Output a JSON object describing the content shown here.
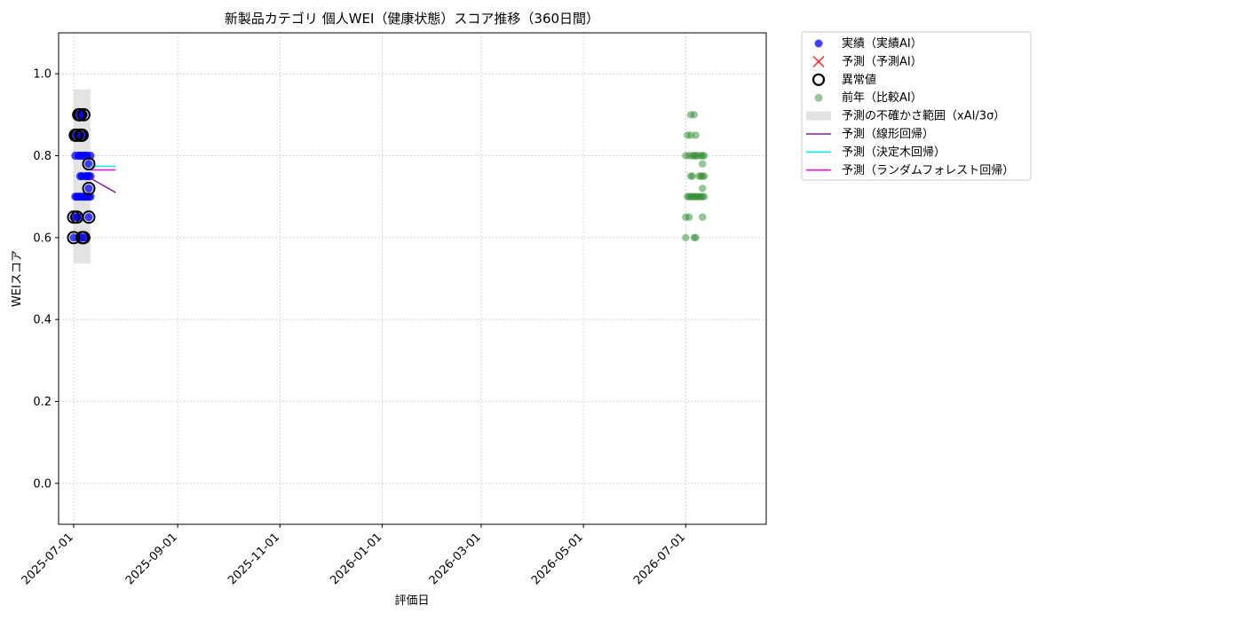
{
  "chart_data": {
    "type": "scatter",
    "title": "新製品カテゴリ 個人WEI（健康状態）スコア推移（360日間）",
    "xlabel": "評価日",
    "ylabel": "WEIスコア",
    "x_type": "date",
    "xlim": [
      "2025-06-22",
      "2026-08-18"
    ],
    "ylim": [
      -0.1,
      1.1
    ],
    "x_ticks": [
      "2025-07-01",
      "2025-09-01",
      "2025-11-01",
      "2026-01-01",
      "2026-03-01",
      "2026-05-01",
      "2026-07-01"
    ],
    "y_ticks": [
      0.0,
      0.2,
      0.4,
      0.6,
      0.8,
      1.0
    ],
    "y_tick_labels": [
      "0.0",
      "0.2",
      "0.4",
      "0.6",
      "0.8",
      "1.0"
    ],
    "grid": true,
    "legend_position": "outside-top-right",
    "legend": [
      {
        "label": "実績（実績AI）",
        "kind": "dot",
        "color": "#0000ff"
      },
      {
        "label": "予測（予測AI）",
        "kind": "x",
        "color": "#ff0000"
      },
      {
        "label": "異常値",
        "kind": "ring",
        "color": "#000000"
      },
      {
        "label": "前年（比較AI）",
        "kind": "dot",
        "color": "#2e8b2e"
      },
      {
        "label": "予測の不確かさ範囲（xAI/3σ）",
        "kind": "band",
        "color": "#c8c8c8"
      },
      {
        "label": "予測（線形回帰）",
        "kind": "line",
        "color": "#8b1a9b"
      },
      {
        "label": "予測（決定木回帰）",
        "kind": "line",
        "color": "#00e5ee"
      },
      {
        "label": "予測（ランダムフォレスト回帰）",
        "kind": "line",
        "color": "#ff00ff"
      }
    ],
    "uncertainty_band": {
      "x": [
        "2025-07-01",
        "2025-07-11"
      ],
      "y": [
        0.537,
        0.962
      ]
    },
    "series": [
      {
        "name": "実績（実績AI）",
        "color": "#0000ff",
        "points": [
          {
            "x": "2025-07-01",
            "y": 0.6
          },
          {
            "x": "2025-07-01",
            "y": 0.65
          },
          {
            "x": "2025-07-02",
            "y": 0.7
          },
          {
            "x": "2025-07-02",
            "y": 0.8
          },
          {
            "x": "2025-07-02",
            "y": 0.85
          },
          {
            "x": "2025-07-03",
            "y": 0.7
          },
          {
            "x": "2025-07-03",
            "y": 0.85
          },
          {
            "x": "2025-07-03",
            "y": 0.65
          },
          {
            "x": "2025-07-04",
            "y": 0.7
          },
          {
            "x": "2025-07-04",
            "y": 0.8
          },
          {
            "x": "2025-07-04",
            "y": 0.9
          },
          {
            "x": "2025-07-04",
            "y": 0.65
          },
          {
            "x": "2025-07-05",
            "y": 0.7
          },
          {
            "x": "2025-07-05",
            "y": 0.75
          },
          {
            "x": "2025-07-05",
            "y": 0.8
          },
          {
            "x": "2025-07-05",
            "y": 0.85
          },
          {
            "x": "2025-07-05",
            "y": 0.9
          },
          {
            "x": "2025-07-06",
            "y": 0.7
          },
          {
            "x": "2025-07-06",
            "y": 0.75
          },
          {
            "x": "2025-07-06",
            "y": 0.8
          },
          {
            "x": "2025-07-06",
            "y": 0.85
          },
          {
            "x": "2025-07-06",
            "y": 0.6
          },
          {
            "x": "2025-07-06",
            "y": 0.9
          },
          {
            "x": "2025-07-07",
            "y": 0.7
          },
          {
            "x": "2025-07-07",
            "y": 0.8
          },
          {
            "x": "2025-07-07",
            "y": 0.9
          },
          {
            "x": "2025-07-07",
            "y": 0.6
          },
          {
            "x": "2025-07-08",
            "y": 0.7
          },
          {
            "x": "2025-07-08",
            "y": 0.8
          },
          {
            "x": "2025-07-08",
            "y": 0.75
          },
          {
            "x": "2025-07-09",
            "y": 0.7
          },
          {
            "x": "2025-07-09",
            "y": 0.75
          },
          {
            "x": "2025-07-09",
            "y": 0.8
          },
          {
            "x": "2025-07-10",
            "y": 0.7
          },
          {
            "x": "2025-07-10",
            "y": 0.75
          },
          {
            "x": "2025-07-10",
            "y": 0.78
          },
          {
            "x": "2025-07-10",
            "y": 0.72
          },
          {
            "x": "2025-07-10",
            "y": 0.65
          },
          {
            "x": "2025-07-11",
            "y": 0.7
          },
          {
            "x": "2025-07-11",
            "y": 0.75
          },
          {
            "x": "2025-07-11",
            "y": 0.8
          }
        ]
      },
      {
        "name": "異常値",
        "color": "#000000",
        "points": [
          {
            "x": "2025-07-01",
            "y": 0.6
          },
          {
            "x": "2025-07-01",
            "y": 0.65
          },
          {
            "x": "2025-07-02",
            "y": 0.85
          },
          {
            "x": "2025-07-03",
            "y": 0.85
          },
          {
            "x": "2025-07-03",
            "y": 0.65
          },
          {
            "x": "2025-07-04",
            "y": 0.9
          },
          {
            "x": "2025-07-05",
            "y": 0.9
          },
          {
            "x": "2025-07-05",
            "y": 0.85
          },
          {
            "x": "2025-07-06",
            "y": 0.85
          },
          {
            "x": "2025-07-06",
            "y": 0.6
          },
          {
            "x": "2025-07-07",
            "y": 0.9
          },
          {
            "x": "2025-07-07",
            "y": 0.6
          },
          {
            "x": "2025-07-10",
            "y": 0.78
          },
          {
            "x": "2025-07-10",
            "y": 0.72
          },
          {
            "x": "2025-07-10",
            "y": 0.65
          }
        ]
      },
      {
        "name": "前年（比較AI）",
        "color": "#2e8b2e",
        "points": [
          {
            "x": "2026-07-01",
            "y": 0.65
          },
          {
            "x": "2026-07-01",
            "y": 0.8
          },
          {
            "x": "2026-07-01",
            "y": 0.6
          },
          {
            "x": "2026-07-02",
            "y": 0.7
          },
          {
            "x": "2026-07-02",
            "y": 0.85
          },
          {
            "x": "2026-07-03",
            "y": 0.65
          },
          {
            "x": "2026-07-03",
            "y": 0.7
          },
          {
            "x": "2026-07-03",
            "y": 0.8
          },
          {
            "x": "2026-07-04",
            "y": 0.9
          },
          {
            "x": "2026-07-04",
            "y": 0.7
          },
          {
            "x": "2026-07-04",
            "y": 0.75
          },
          {
            "x": "2026-07-04",
            "y": 0.85
          },
          {
            "x": "2026-07-05",
            "y": 0.7
          },
          {
            "x": "2026-07-05",
            "y": 0.8
          },
          {
            "x": "2026-07-05",
            "y": 0.75
          },
          {
            "x": "2026-07-06",
            "y": 0.8
          },
          {
            "x": "2026-07-06",
            "y": 0.6
          },
          {
            "x": "2026-07-06",
            "y": 0.7
          },
          {
            "x": "2026-07-06",
            "y": 0.9
          },
          {
            "x": "2026-07-07",
            "y": 0.7
          },
          {
            "x": "2026-07-07",
            "y": 0.8
          },
          {
            "x": "2026-07-07",
            "y": 0.6
          },
          {
            "x": "2026-07-07",
            "y": 0.85
          },
          {
            "x": "2026-07-08",
            "y": 0.7
          },
          {
            "x": "2026-07-08",
            "y": 0.8
          },
          {
            "x": "2026-07-09",
            "y": 0.7
          },
          {
            "x": "2026-07-09",
            "y": 0.75
          },
          {
            "x": "2026-07-10",
            "y": 0.7
          },
          {
            "x": "2026-07-10",
            "y": 0.8
          },
          {
            "x": "2026-07-10",
            "y": 0.75
          },
          {
            "x": "2026-07-11",
            "y": 0.7
          },
          {
            "x": "2026-07-11",
            "y": 0.72
          },
          {
            "x": "2026-07-11",
            "y": 0.78
          },
          {
            "x": "2026-07-11",
            "y": 0.65
          },
          {
            "x": "2026-07-11",
            "y": 0.75
          },
          {
            "x": "2026-07-11",
            "y": 0.8
          },
          {
            "x": "2026-07-12",
            "y": 0.7
          },
          {
            "x": "2026-07-12",
            "y": 0.75
          },
          {
            "x": "2026-07-12",
            "y": 0.8
          }
        ]
      }
    ],
    "prediction_lines": [
      {
        "name": "予測（線形回帰）",
        "color": "#8b1a9b",
        "points": [
          {
            "x": "2025-07-11",
            "y": 0.745
          },
          {
            "x": "2025-07-26",
            "y": 0.71
          }
        ]
      },
      {
        "name": "予測（決定木回帰）",
        "color": "#00e5ee",
        "points": [
          {
            "x": "2025-07-11",
            "y": 0.774
          },
          {
            "x": "2025-07-26",
            "y": 0.774
          }
        ]
      },
      {
        "name": "予測（ランダムフォレスト回帰）",
        "color": "#ff00ff",
        "points": [
          {
            "x": "2025-07-11",
            "y": 0.765
          },
          {
            "x": "2025-07-26",
            "y": 0.765
          }
        ]
      }
    ]
  }
}
